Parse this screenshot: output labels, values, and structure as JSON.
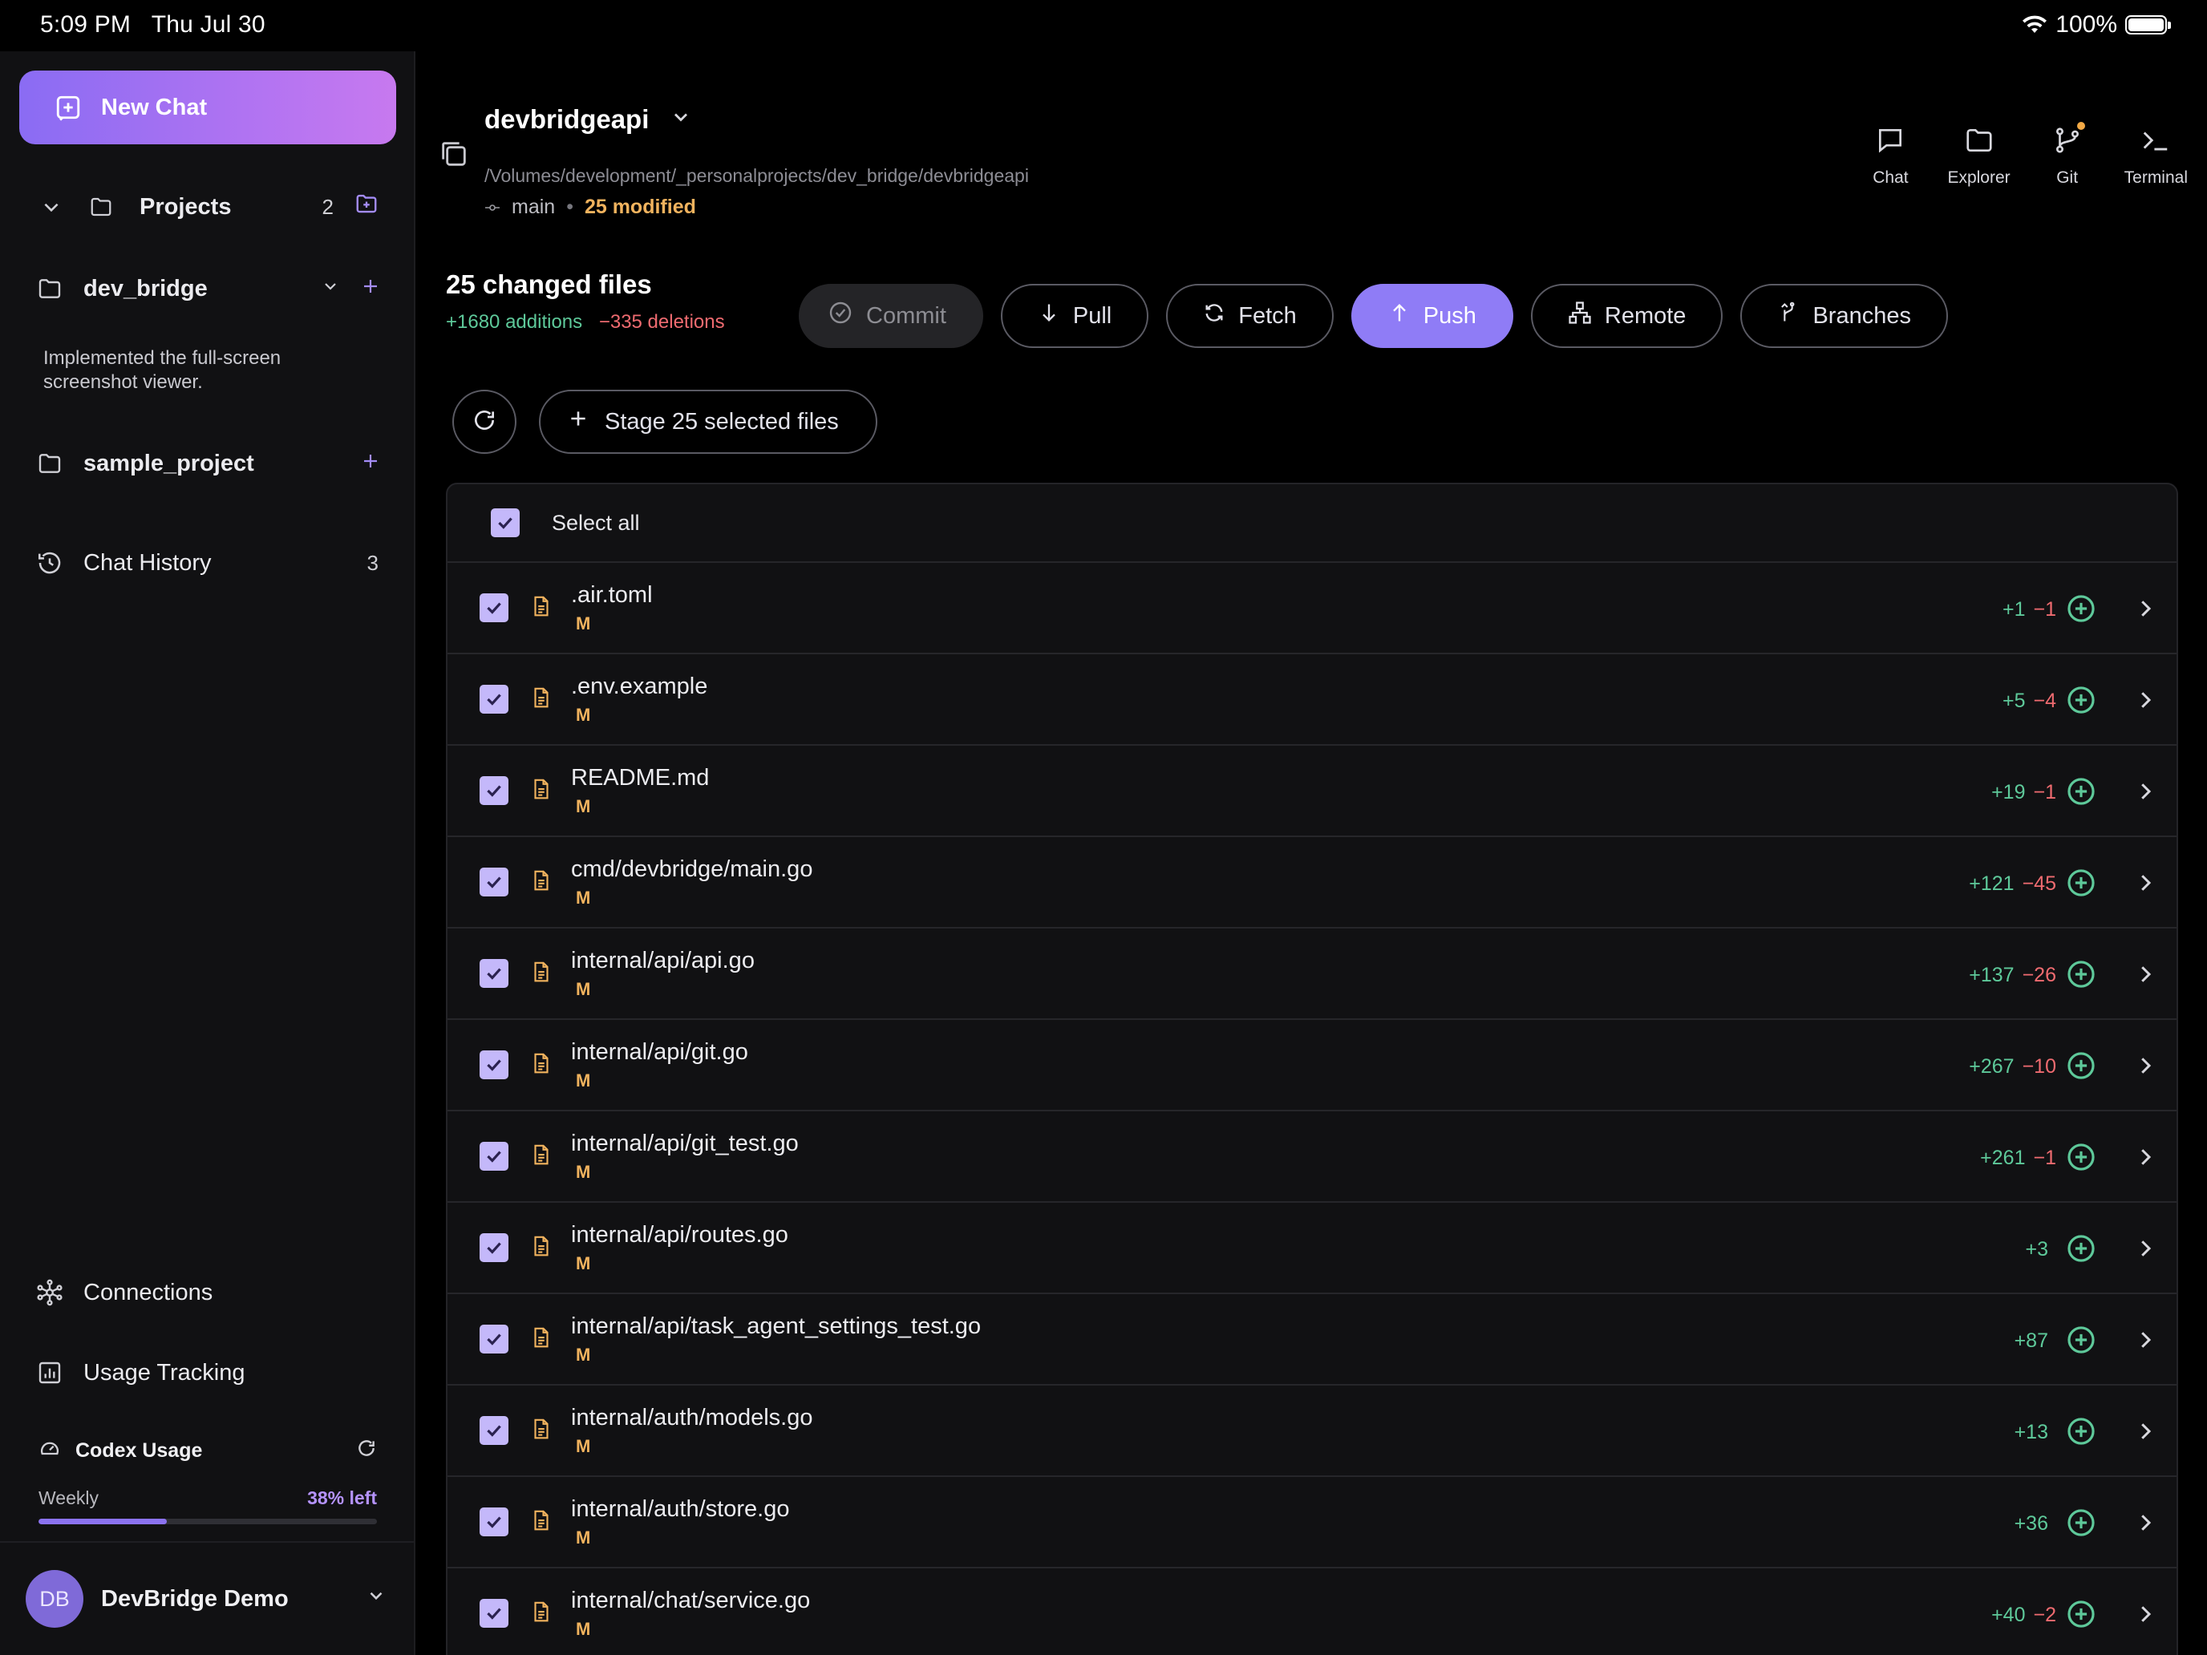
{
  "status_bar": {
    "time": "5:09 PM",
    "date": "Thu Jul 30",
    "battery": "100%"
  },
  "sidebar": {
    "new_chat": "New Chat",
    "projects_label": "Projects",
    "projects_count": "2",
    "project1": {
      "name": "dev_bridge",
      "description": "Implemented the full-screen screenshot viewer."
    },
    "project2": {
      "name": "sample_project"
    },
    "chat_history_label": "Chat History",
    "chat_history_count": "3",
    "connections": "Connections",
    "usage_tracking": "Usage Tracking",
    "codex": {
      "title": "Codex Usage",
      "period": "Weekly",
      "left": "38% left",
      "used_fraction": 0.38
    },
    "user": {
      "initials": "DB",
      "name": "DevBridge Demo"
    }
  },
  "header": {
    "project": "devbridgeapi",
    "path": "/Volumes/development/_personalprojects/dev_bridge/devbridgeapi",
    "branch": "main",
    "separator": "•",
    "modified": "25 modified",
    "nav": {
      "chat": "Chat",
      "explorer": "Explorer",
      "git": "Git",
      "terminal": "Terminal"
    }
  },
  "summary": {
    "changed": "25 changed files",
    "additions": "+1680 additions",
    "deletions": "−335 deletions"
  },
  "actions": {
    "commit": "Commit",
    "pull": "Pull",
    "fetch": "Fetch",
    "push": "Push",
    "remote": "Remote",
    "branches": "Branches",
    "stage": "Stage 25 selected files"
  },
  "filelist": {
    "select_all": "Select all",
    "files": [
      {
        "name": ".air.toml",
        "status": "M",
        "add": "+1",
        "del": "−1"
      },
      {
        "name": ".env.example",
        "status": "M",
        "add": "+5",
        "del": "−4"
      },
      {
        "name": "README.md",
        "status": "M",
        "add": "+19",
        "del": "−1"
      },
      {
        "name": "cmd/devbridge/main.go",
        "status": "M",
        "add": "+121",
        "del": "−45"
      },
      {
        "name": "internal/api/api.go",
        "status": "M",
        "add": "+137",
        "del": "−26"
      },
      {
        "name": "internal/api/git.go",
        "status": "M",
        "add": "+267",
        "del": "−10"
      },
      {
        "name": "internal/api/git_test.go",
        "status": "M",
        "add": "+261",
        "del": "−1"
      },
      {
        "name": "internal/api/routes.go",
        "status": "M",
        "add": "+3",
        "del": ""
      },
      {
        "name": "internal/api/task_agent_settings_test.go",
        "status": "M",
        "add": "+87",
        "del": ""
      },
      {
        "name": "internal/auth/models.go",
        "status": "M",
        "add": "+13",
        "del": ""
      },
      {
        "name": "internal/auth/store.go",
        "status": "M",
        "add": "+36",
        "del": ""
      },
      {
        "name": "internal/chat/service.go",
        "status": "M",
        "add": "+40",
        "del": "−2"
      }
    ]
  },
  "colors": {
    "accent": "#8f7cf6",
    "addition": "#5ec99a",
    "deletion": "#ef6b70",
    "modified": "#f1b35e"
  }
}
